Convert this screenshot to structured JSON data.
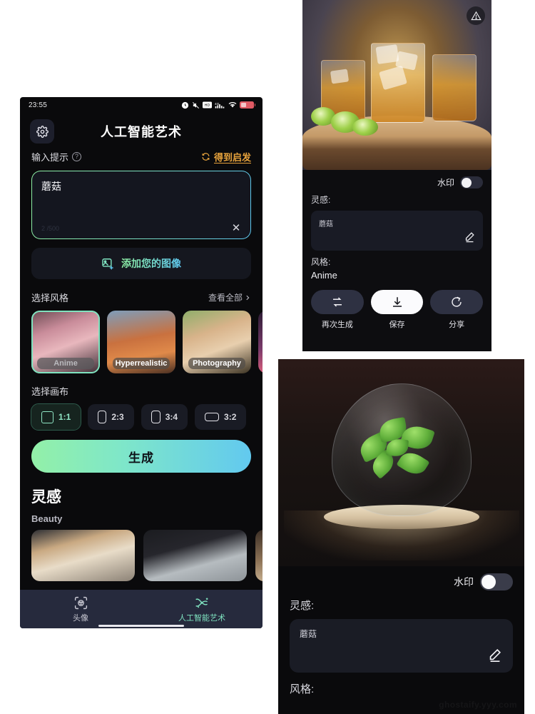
{
  "phone": {
    "status_bar": {
      "time": "23:55",
      "icons": [
        "alarm-icon",
        "mute-icon",
        "hd-icon",
        "signal-4g-icon",
        "wifi-icon",
        "battery-icon"
      ]
    },
    "app_title": "人工智能艺术",
    "settings_icon": "gear-icon",
    "prompt": {
      "label": "输入提示",
      "help_icon": "question-icon",
      "inspire_label": "得到启发",
      "inspire_icon": "refresh-icon",
      "value": "蘑菇",
      "placeholder": "蘑菇",
      "char_count": "2 /500",
      "clear_icon": "close-icon"
    },
    "add_image": {
      "label": "添加您的图像",
      "icon": "image-plus-icon"
    },
    "style": {
      "title": "选择风格",
      "see_all": "查看全部",
      "see_all_icon": "chevron-right-icon",
      "items": [
        {
          "name": "Anime",
          "selected": true
        },
        {
          "name": "Hyperrealistic",
          "selected": false
        },
        {
          "name": "Photography",
          "selected": false
        },
        {
          "name": "",
          "selected": false
        }
      ]
    },
    "canvas": {
      "title": "选择画布",
      "options": [
        {
          "label": "1:1",
          "selected": true
        },
        {
          "label": "2:3",
          "selected": false
        },
        {
          "label": "3:4",
          "selected": false
        },
        {
          "label": "3:2",
          "selected": false
        }
      ]
    },
    "generate_button": "生成",
    "inspiration": {
      "title": "灵感",
      "category": "Beauty",
      "cards": [
        "blonde-portrait",
        "dark-hair-portrait",
        "window-scene"
      ]
    },
    "tabs": [
      {
        "label": "头像",
        "icon": "avatar-icon",
        "active": false
      },
      {
        "label": "人工智能艺术",
        "icon": "ai-art-icon",
        "active": true
      }
    ]
  },
  "result_top": {
    "warning_icon": "warning-icon",
    "watermark": {
      "label": "水印",
      "enabled": false
    },
    "inspiration_label": "灵感:",
    "inspiration_value": "蘑菇",
    "edit_icon": "pencil-icon",
    "style_label": "风格:",
    "style_value": "Anime",
    "actions": [
      {
        "label": "再次生成",
        "icon": "regenerate-icon",
        "primary": false
      },
      {
        "label": "保存",
        "icon": "download-icon",
        "primary": true
      },
      {
        "label": "分享",
        "icon": "share-icon",
        "primary": false
      }
    ]
  },
  "result_bottom": {
    "watermark": {
      "label": "水印",
      "enabled": false
    },
    "inspiration_label": "灵感:",
    "inspiration_value": "蘑菇",
    "edit_icon": "pencil-icon",
    "style_label": "风格:",
    "page_watermark": "ghostaify.yyy.com"
  },
  "colors": {
    "accent_green": "#8ff0a4",
    "accent_blue": "#5ec8f0",
    "inspire_orange": "#e6a23c",
    "tabbar": "#262a3d",
    "background": "#0a0a0c"
  }
}
